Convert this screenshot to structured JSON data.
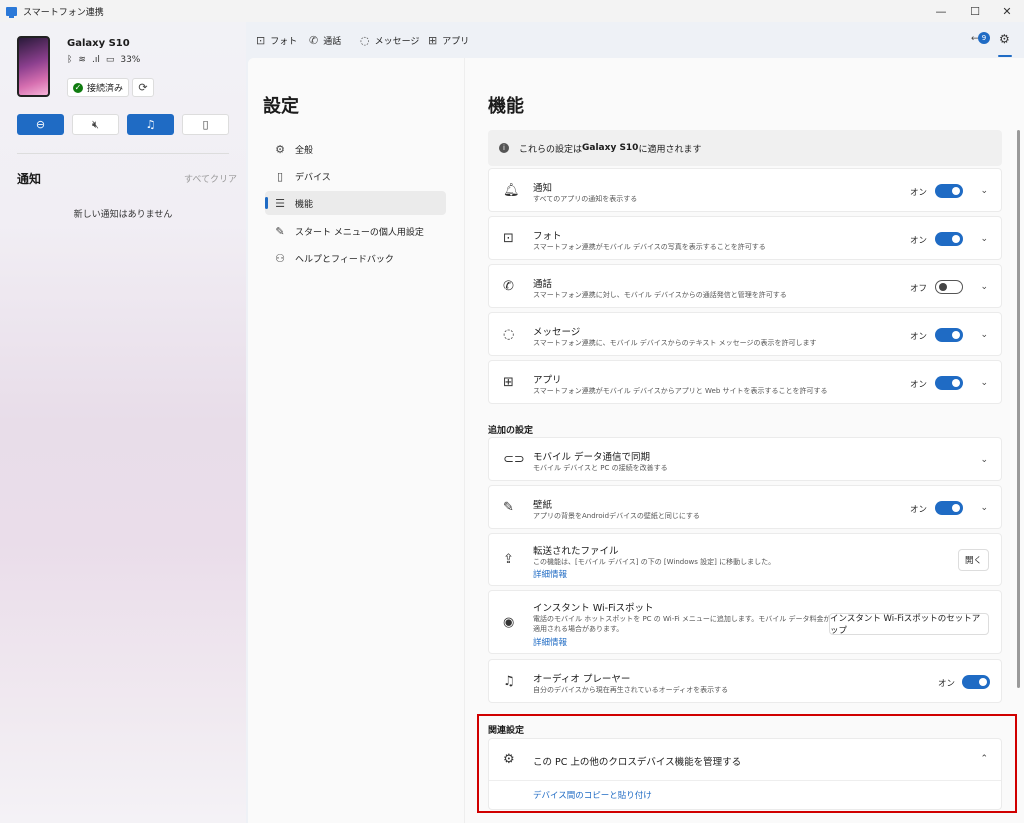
{
  "window": {
    "title": "スマートフォン連携"
  },
  "device": {
    "name": "Galaxy S10",
    "battery": "33%",
    "connection": "接続済み"
  },
  "notifications": {
    "title": "通知",
    "clear_all": "すべてクリア",
    "empty": "新しい通知はありません"
  },
  "nav": {
    "photos": "フォト",
    "calls": "通話",
    "messages": "メッセージ",
    "apps": "アプリ",
    "badge": "9"
  },
  "settings": {
    "title": "設定",
    "items": [
      {
        "label": "全般",
        "icon": "gear-icon"
      },
      {
        "label": "デバイス",
        "icon": "phone-icon"
      },
      {
        "label": "機能",
        "icon": "list-icon"
      },
      {
        "label": "スタート メニューの個人用設定",
        "icon": "pen-icon"
      },
      {
        "label": "ヘルプとフィードバック",
        "icon": "people-icon"
      }
    ]
  },
  "features": {
    "title": "機能",
    "info_prefix": "これらの設定は ",
    "info_device": "Galaxy S10",
    "info_suffix": " に適用されます",
    "rows": [
      {
        "title": "通知",
        "desc": "すべてのアプリの通知を表示する",
        "state": "オン",
        "on": true,
        "icon": "bell-icon"
      },
      {
        "title": "フォト",
        "desc": "スマートフォン連携がモバイル デバイスの写真を表示することを許可する",
        "state": "オン",
        "on": true,
        "icon": "photo-icon"
      },
      {
        "title": "通話",
        "desc": "スマートフォン連携に対し、モバイル デバイスからの通話発信と管理を許可する",
        "state": "オフ",
        "on": false,
        "icon": "call-icon"
      },
      {
        "title": "メッセージ",
        "desc": "スマートフォン連携に、モバイル デバイスからのテキスト メッセージの表示を許可します",
        "state": "オン",
        "on": true,
        "icon": "message-icon"
      },
      {
        "title": "アプリ",
        "desc": "スマートフォン連携がモバイル デバイスからアプリと Web サイトを表示することを許可する",
        "state": "オン",
        "on": true,
        "icon": "apps-icon"
      }
    ]
  },
  "additional": {
    "title": "追加の設定",
    "mobile_sync": {
      "title": "モバイル データ通信で同期",
      "desc": "モバイル デバイスと PC の接続を改善する"
    },
    "wallpaper": {
      "title": "壁紙",
      "desc": "アプリの背景をAndroidデバイスの壁紙と同じにする",
      "state": "オン"
    },
    "transferred": {
      "title": "転送されたファイル",
      "desc": "この機能は、[モバイル デバイス] の下の [Windows 設定] に移動しました。",
      "link": "詳細情報",
      "button": "開く"
    },
    "hotspot": {
      "title": "インスタント Wi-Fiスポット",
      "desc1": "電話のモバイル ホットスポットを PC の Wi-Fi メニューに追加します。モバイル データ料金が",
      "desc2": "適用される場合があります。",
      "link": "詳細情報",
      "button": "インスタント Wi-Fiスポットのセットアップ"
    },
    "audio": {
      "title": "オーディオ プレーヤー",
      "desc": "自分のデバイスから現在再生されているオーディオを表示する",
      "state": "オン"
    }
  },
  "related": {
    "title": "関連設定",
    "cross_device": "この PC 上の他のクロスデバイス機能を管理する",
    "copy_paste": "デバイス間のコピーと貼り付け"
  },
  "colors": {
    "accent": "#1f6bc4",
    "highlight": "#d00000"
  }
}
